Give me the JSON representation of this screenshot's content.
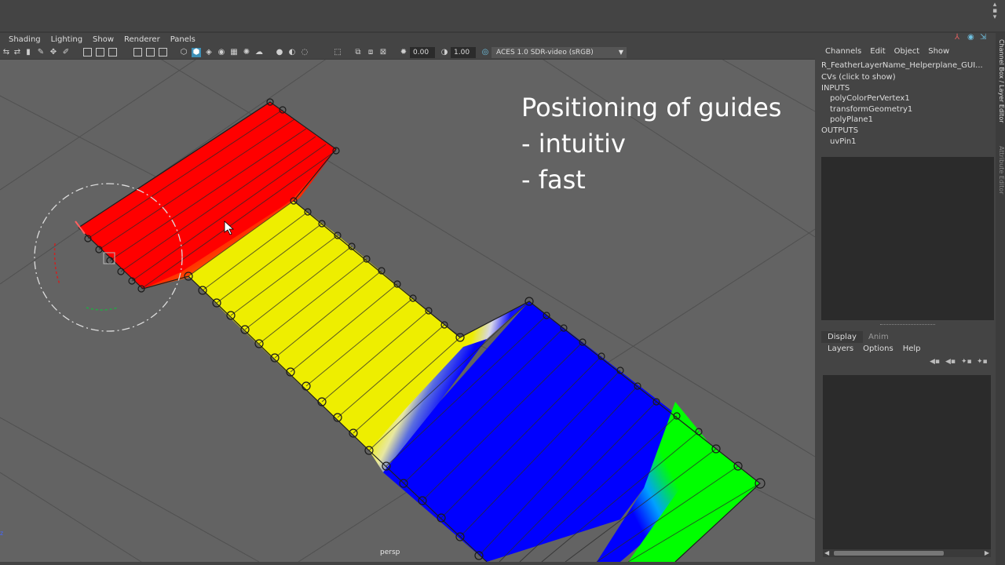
{
  "viewport": {
    "menu": [
      "Shading",
      "Lighting",
      "Show",
      "Renderer",
      "Panels"
    ],
    "toolbar": {
      "value_a": "0.00",
      "value_b": "1.00",
      "color_space": "ACES 1.0 SDR-video (sRGB)"
    },
    "camera_label": "persp",
    "overlay": {
      "title": "Positioning of guides",
      "line1": "- intuitiv",
      "line2": "- fast"
    },
    "colors": {
      "red": "#ff0000",
      "yellow": "#eeee00",
      "blue": "#0000ff",
      "green": "#00ff00",
      "grid": "#4e4e4e"
    }
  },
  "channel_box": {
    "menu": [
      "Channels",
      "Edit",
      "Object",
      "Show"
    ],
    "node_name": "R_FeatherLayerName_Helperplane_GUI...",
    "cvs": "CVs (click to show)",
    "inputs_header": "INPUTS",
    "inputs": [
      "polyColorPerVertex1",
      "transformGeometry1",
      "polyPlane1"
    ],
    "outputs_header": "OUTPUTS",
    "outputs": [
      "uvPin1"
    ]
  },
  "layer_editor": {
    "tabs": [
      "Display",
      "Anim"
    ],
    "submenu": [
      "Layers",
      "Options",
      "Help"
    ]
  },
  "side_tabs": [
    "Channel Box / Layer Editor",
    "Attribute Editor"
  ]
}
